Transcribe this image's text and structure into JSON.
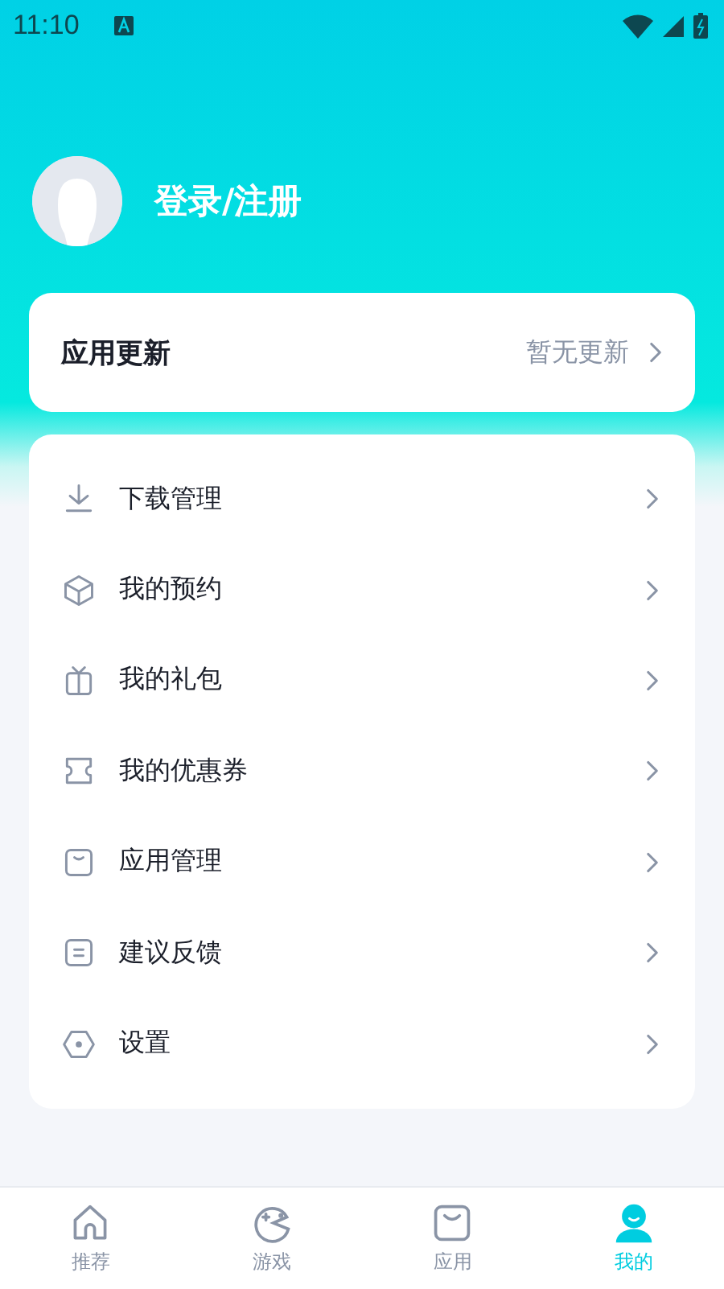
{
  "status_bar": {
    "time": "11:10"
  },
  "profile": {
    "login_label": "登录/注册"
  },
  "update_card": {
    "title": "应用更新",
    "status": "暂无更新"
  },
  "menu": [
    {
      "kind": "download",
      "label": "下载管理"
    },
    {
      "kind": "box",
      "label": "我的预约"
    },
    {
      "kind": "gift",
      "label": "我的礼包"
    },
    {
      "kind": "ticket",
      "label": "我的优惠券"
    },
    {
      "kind": "app",
      "label": "应用管理"
    },
    {
      "kind": "feedback",
      "label": "建议反馈"
    },
    {
      "kind": "settings",
      "label": "设置"
    }
  ],
  "tabs": [
    {
      "kind": "home",
      "label": "推荐",
      "selected": false
    },
    {
      "kind": "game",
      "label": "游戏",
      "selected": false
    },
    {
      "kind": "app",
      "label": "应用",
      "selected": false
    },
    {
      "kind": "me",
      "label": "我的",
      "selected": true
    }
  ]
}
